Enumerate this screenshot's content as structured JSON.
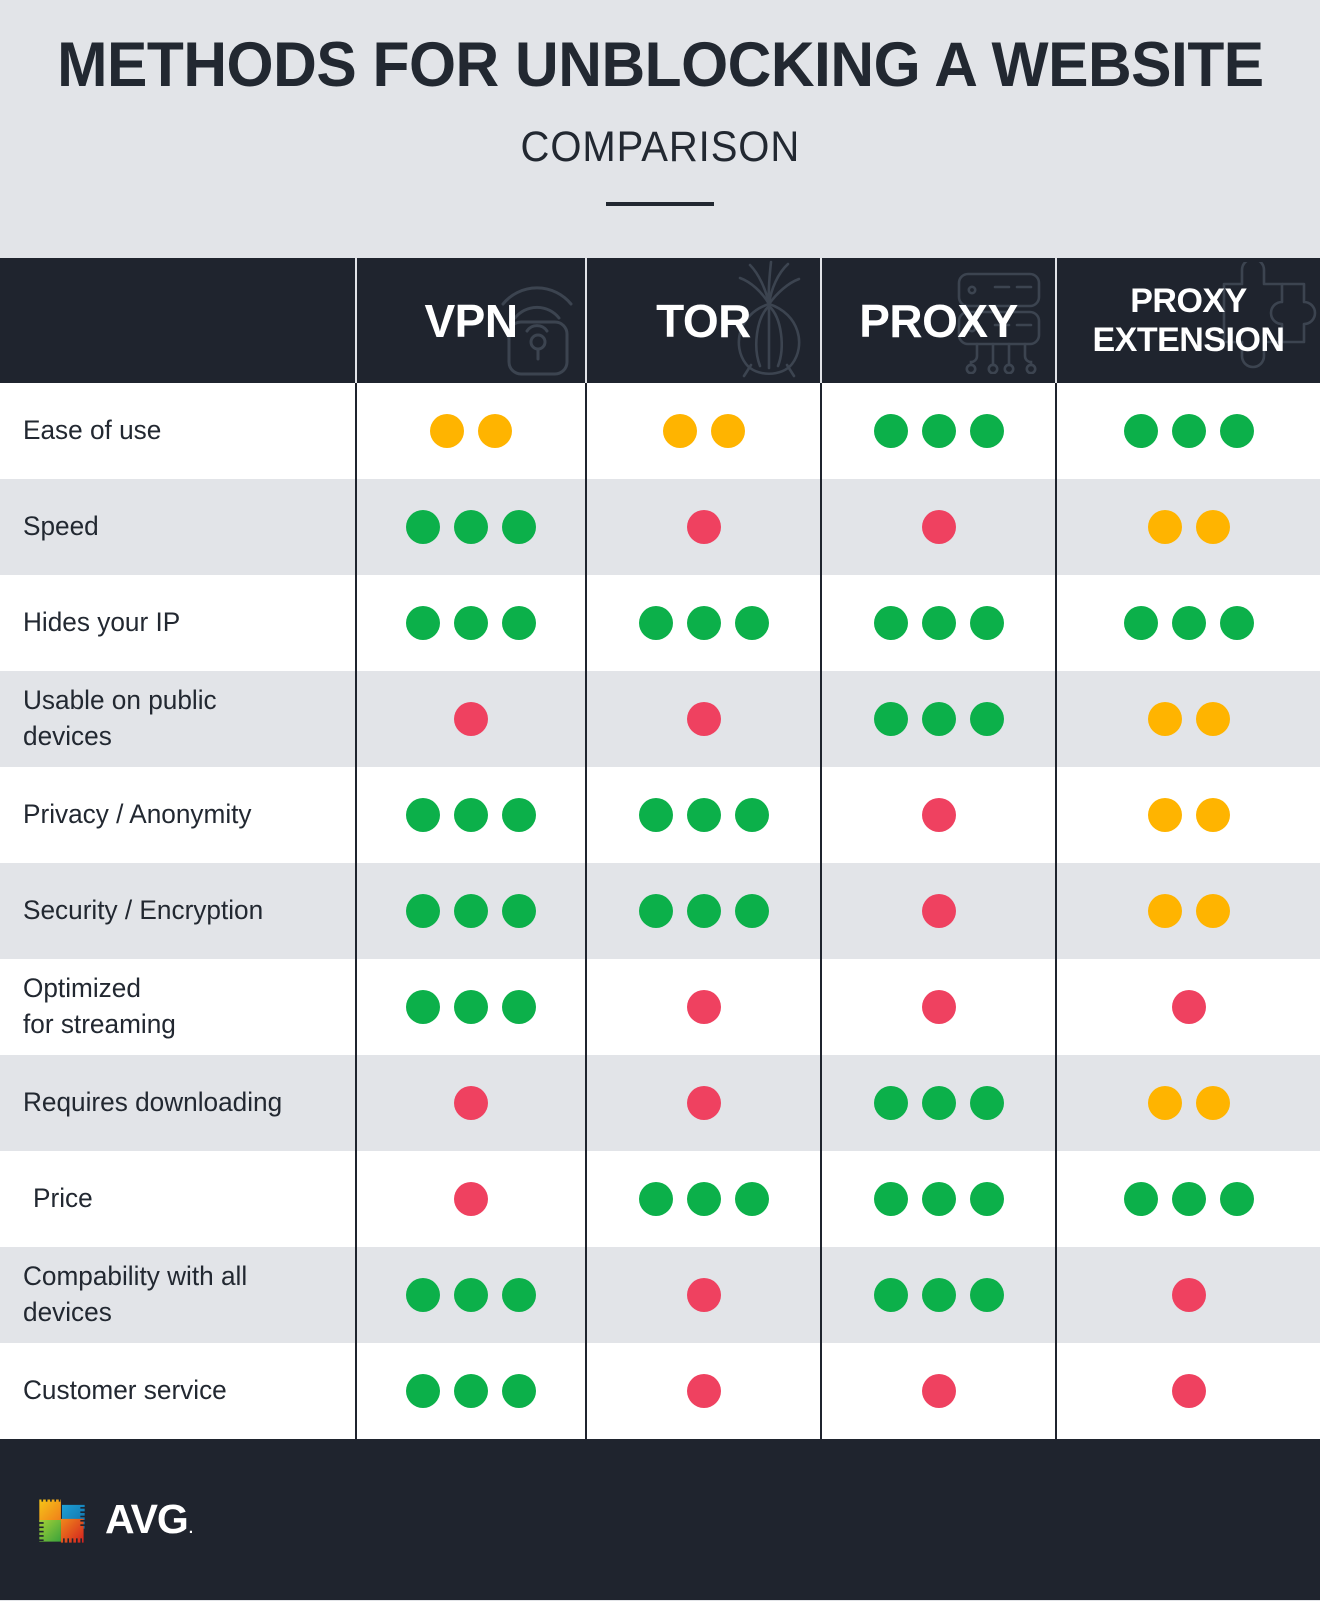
{
  "header": {
    "title": "METHODS FOR UNBLOCKING A WEBSITE",
    "subtitle": "COMPARISON"
  },
  "colors": {
    "background": "#e2e4e8",
    "dark": "#1f242e",
    "row_alt": "#e2e4e8",
    "row_plain": "#ffffff",
    "green": "#0cb04a",
    "amber": "#ffb400",
    "red": "#ef4160",
    "text": "#222831"
  },
  "table": {
    "columns": [
      {
        "label": "VPN",
        "icon": "lock-wifi-icon"
      },
      {
        "label": "TOR",
        "icon": "onion-icon"
      },
      {
        "label": "PROXY",
        "icon": "server-circuit-icon"
      },
      {
        "label": "PROXY\nEXTENSION",
        "icon": "puzzle-piece-icon"
      }
    ],
    "rows": [
      {
        "label": "Ease of use",
        "ratings": [
          {
            "color": "amber",
            "count": 2
          },
          {
            "color": "amber",
            "count": 2
          },
          {
            "color": "green",
            "count": 3
          },
          {
            "color": "green",
            "count": 3
          }
        ]
      },
      {
        "label": "Speed",
        "ratings": [
          {
            "color": "green",
            "count": 3
          },
          {
            "color": "red",
            "count": 1
          },
          {
            "color": "red",
            "count": 1
          },
          {
            "color": "amber",
            "count": 2
          }
        ]
      },
      {
        "label": "Hides your IP",
        "ratings": [
          {
            "color": "green",
            "count": 3
          },
          {
            "color": "green",
            "count": 3
          },
          {
            "color": "green",
            "count": 3
          },
          {
            "color": "green",
            "count": 3
          }
        ]
      },
      {
        "label": "Usable on public\ndevices",
        "ratings": [
          {
            "color": "red",
            "count": 1
          },
          {
            "color": "red",
            "count": 1
          },
          {
            "color": "green",
            "count": 3
          },
          {
            "color": "amber",
            "count": 2
          }
        ]
      },
      {
        "label": "Privacy / Anonymity",
        "ratings": [
          {
            "color": "green",
            "count": 3
          },
          {
            "color": "green",
            "count": 3
          },
          {
            "color": "red",
            "count": 1
          },
          {
            "color": "amber",
            "count": 2
          }
        ]
      },
      {
        "label": "Security / Encryption",
        "ratings": [
          {
            "color": "green",
            "count": 3
          },
          {
            "color": "green",
            "count": 3
          },
          {
            "color": "red",
            "count": 1
          },
          {
            "color": "amber",
            "count": 2
          }
        ]
      },
      {
        "label": "Optimized\nfor streaming",
        "ratings": [
          {
            "color": "green",
            "count": 3
          },
          {
            "color": "red",
            "count": 1
          },
          {
            "color": "red",
            "count": 1
          },
          {
            "color": "red",
            "count": 1
          }
        ]
      },
      {
        "label": "Requires downloading",
        "ratings": [
          {
            "color": "red",
            "count": 1
          },
          {
            "color": "red",
            "count": 1
          },
          {
            "color": "green",
            "count": 3
          },
          {
            "color": "amber",
            "count": 2
          }
        ]
      },
      {
        "label": "Price",
        "indented": true,
        "ratings": [
          {
            "color": "red",
            "count": 1
          },
          {
            "color": "green",
            "count": 3
          },
          {
            "color": "green",
            "count": 3
          },
          {
            "color": "green",
            "count": 3
          }
        ]
      },
      {
        "label": "Compability with all\ndevices",
        "ratings": [
          {
            "color": "green",
            "count": 3
          },
          {
            "color": "red",
            "count": 1
          },
          {
            "color": "green",
            "count": 3
          },
          {
            "color": "red",
            "count": 1
          }
        ]
      },
      {
        "label": "Customer service",
        "ratings": [
          {
            "color": "green",
            "count": 3
          },
          {
            "color": "red",
            "count": 1
          },
          {
            "color": "red",
            "count": 1
          },
          {
            "color": "red",
            "count": 1
          }
        ]
      }
    ]
  },
  "footer": {
    "brand": "AVG",
    "trademark": "."
  }
}
